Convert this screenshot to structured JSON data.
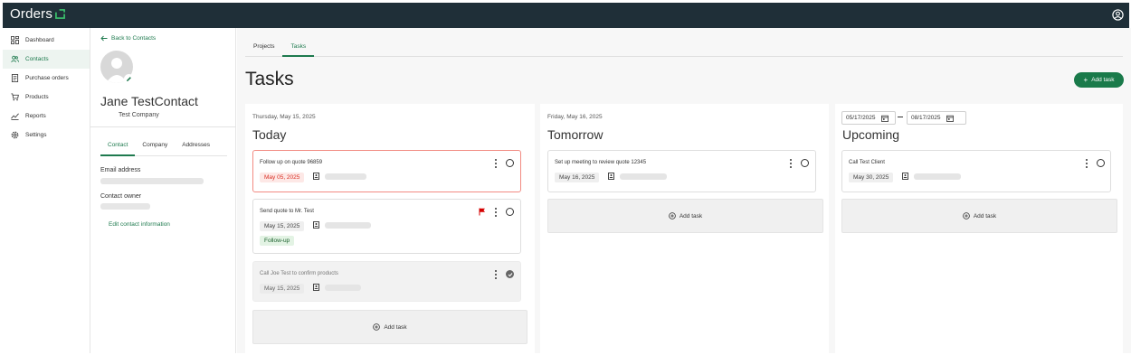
{
  "app": {
    "title": "Orders"
  },
  "sidebar": {
    "items": [
      {
        "label": "Dashboard",
        "icon": "dashboard-icon",
        "active": false
      },
      {
        "label": "Contacts",
        "icon": "contacts-icon",
        "active": true
      },
      {
        "label": "Purchase orders",
        "icon": "purchase-orders-icon",
        "active": false
      },
      {
        "label": "Products",
        "icon": "cart-icon",
        "active": false
      },
      {
        "label": "Reports",
        "icon": "reports-icon",
        "active": false
      },
      {
        "label": "Settings",
        "icon": "gear-icon",
        "active": false
      }
    ]
  },
  "contact": {
    "back_label": "Back to Contacts",
    "name": "Jane TestContact",
    "company": "Test Company",
    "tabs": [
      "Contact",
      "Company",
      "Addresses"
    ],
    "email_label": "Email address",
    "owner_label": "Contact owner",
    "edit_label": "Edit contact information"
  },
  "main": {
    "tabs": [
      "Projects",
      "Tasks"
    ],
    "title": "Tasks",
    "add_task_button": "Add task"
  },
  "columns": [
    {
      "date": "Thursday, May 15, 2025",
      "title": "Today",
      "tasks": [
        {
          "title": "Follow up on quote 96859",
          "date": "May 05, 2025",
          "overdue": true,
          "flag": false,
          "done": false,
          "tag": ""
        },
        {
          "title": "Send quote to Mr. Test",
          "date": "May 15, 2025",
          "overdue": false,
          "flag": true,
          "done": false,
          "tag": "Follow-up"
        },
        {
          "title": "Call Joe Test to confirm products",
          "date": "May 15, 2025",
          "overdue": false,
          "flag": false,
          "done": true,
          "tag": ""
        }
      ],
      "add_label": "Add task"
    },
    {
      "date": "Friday, May 16, 2025",
      "title": "Tomorrow",
      "tasks": [
        {
          "title": "Set up meeting to review quote 12345",
          "date": "May 16, 2025",
          "overdue": false,
          "flag": false,
          "done": false,
          "tag": ""
        }
      ],
      "add_label": "Add task"
    },
    {
      "date_from": "05/17/2025",
      "date_to": "08/17/2025",
      "title": "Upcoming",
      "tasks": [
        {
          "title": "Call Test Client",
          "date": "May 30, 2025",
          "overdue": false,
          "flag": false,
          "done": false,
          "tag": ""
        }
      ],
      "add_label": "Add task"
    }
  ],
  "colors": {
    "topbar": "#1f2f38",
    "accent": "#1a7a4a",
    "overdue": "#d93025",
    "flag": "#d50000"
  }
}
